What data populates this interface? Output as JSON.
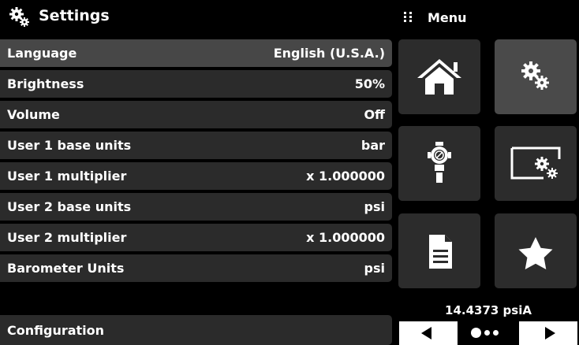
{
  "header": {
    "title": "Settings"
  },
  "menu": {
    "title": "Menu"
  },
  "settings": [
    {
      "label": "Language",
      "value": "English (U.S.A.)"
    },
    {
      "label": "Brightness",
      "value": "50%"
    },
    {
      "label": "Volume",
      "value": "Off"
    },
    {
      "label": "User 1 base units",
      "value": "bar"
    },
    {
      "label": "User 1 multiplier",
      "value": "x 1.000000"
    },
    {
      "label": "User 2 base units",
      "value": "psi"
    },
    {
      "label": "User 2 multiplier",
      "value": "x 1.000000"
    },
    {
      "label": "Barometer Units",
      "value": "psi"
    }
  ],
  "configuration": {
    "label": "Configuration"
  },
  "tiles": [
    {
      "icon": "home-icon"
    },
    {
      "icon": "settings-gears-icon"
    },
    {
      "icon": "pressure-sensor-icon"
    },
    {
      "icon": "display-settings-icon"
    },
    {
      "icon": "document-icon"
    },
    {
      "icon": "favorites-star-icon"
    }
  ],
  "status": {
    "barometer_reading": "14.4373 psiA"
  },
  "colors": {
    "background": "#000000",
    "row": "#2b2b2b",
    "row_selected": "#474747",
    "tile": "#2c2c2c",
    "tile_active": "#4a4a4a"
  }
}
